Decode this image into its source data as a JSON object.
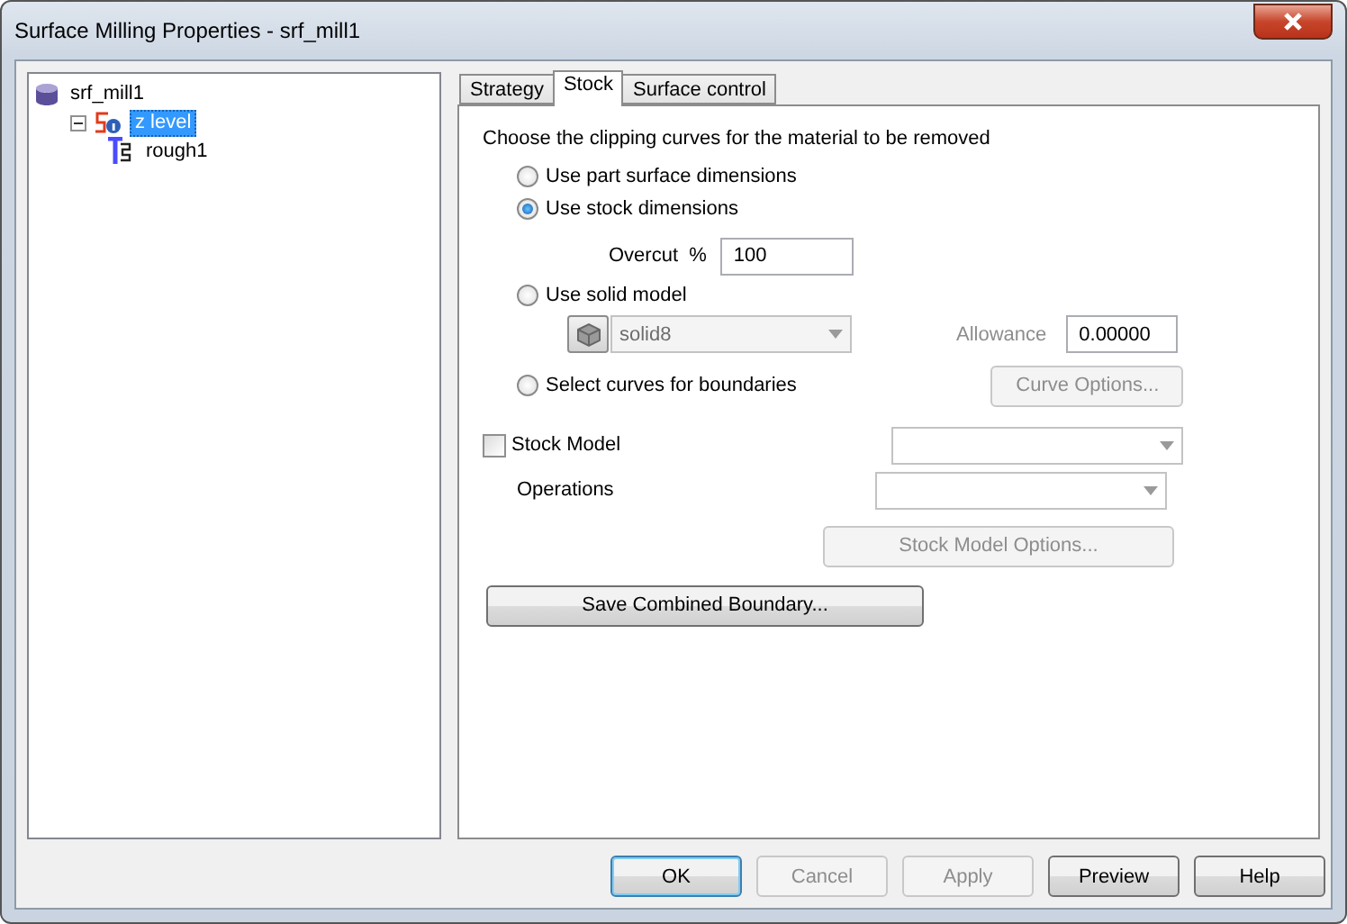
{
  "window": {
    "title": "Surface Milling Properties - srf_mill1"
  },
  "tree": [
    {
      "label": "srf_mill1",
      "kind": "database",
      "selected": false,
      "children": [
        {
          "label": "z level",
          "kind": "strategy",
          "selected": true,
          "expanded": true,
          "children": [
            {
              "label": "rough1",
              "kind": "pass",
              "selected": false
            }
          ]
        }
      ]
    }
  ],
  "tabs": [
    {
      "label": "Strategy",
      "selected": false
    },
    {
      "label": "Stock",
      "selected": true
    },
    {
      "label": "Surface control",
      "selected": false
    }
  ],
  "stock": {
    "instruction": "Choose the clipping curves for the material to be removed",
    "options": [
      {
        "label": "Use part surface dimensions",
        "selected": false
      },
      {
        "label": "Use stock dimensions",
        "selected": true
      },
      {
        "label": "Use solid model",
        "selected": false
      },
      {
        "label": "Select curves for boundaries",
        "selected": false
      }
    ],
    "overcut_label": "Overcut  %",
    "overcut_value": "100",
    "solid_value": "solid8",
    "allowance_label": "Allowance",
    "allowance_value": "0.00000",
    "curve_options": {
      "label": "Curve Options...",
      "disabled": true
    },
    "stock_model": {
      "label": "Stock Model",
      "checked": false
    },
    "operations_label": "Operations",
    "stock_model_options": {
      "label": "Stock Model Options...",
      "disabled": true
    },
    "save_boundary": {
      "label": "Save Combined Boundary...",
      "disabled": false
    }
  },
  "buttons": [
    {
      "label": "OK",
      "disabled": false,
      "default": true
    },
    {
      "label": "Cancel",
      "disabled": true,
      "default": false
    },
    {
      "label": "Apply",
      "disabled": true,
      "default": false
    },
    {
      "label": "Preview",
      "disabled": false,
      "default": false
    },
    {
      "label": "Help",
      "disabled": false,
      "default": false
    }
  ]
}
